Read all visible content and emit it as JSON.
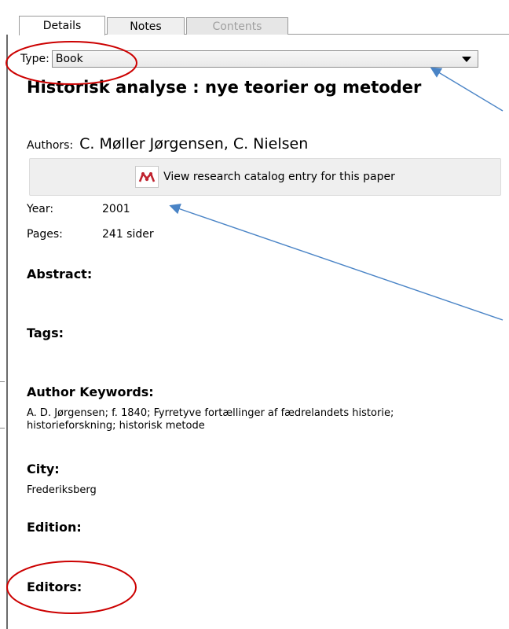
{
  "tabs": [
    {
      "label": "Details"
    },
    {
      "label": "Notes"
    },
    {
      "label": "Contents"
    }
  ],
  "type_field": {
    "label": "Type:",
    "value": "Book"
  },
  "document": {
    "title": "Historisk analyse : nye teorier og metoder",
    "authors_label": "Authors:",
    "authors": "C. Møller Jørgensen, C. Nielsen",
    "catalog_button": "View research catalog entry for this paper",
    "year_label": "Year:",
    "year": "2001",
    "pages_label": "Pages:",
    "pages": "241 sider"
  },
  "sections": {
    "abstract": "Abstract:",
    "tags": "Tags:",
    "author_keywords": "Author Keywords:",
    "author_keywords_value": "A. D. Jørgensen; f. 1840; Fyrretyve fortællinger af fædrelandets historie; historieforskning; historisk metode",
    "city": "City:",
    "city_value": "Frederiksberg",
    "edition": "Edition:",
    "editors": "Editors:"
  },
  "colors": {
    "annotation_circle": "#cc0000",
    "annotation_arrow": "#4a84c6",
    "icon_red": "#c0232f"
  },
  "icons": [
    "mendeley-icon",
    "dropdown-caret-icon"
  ]
}
